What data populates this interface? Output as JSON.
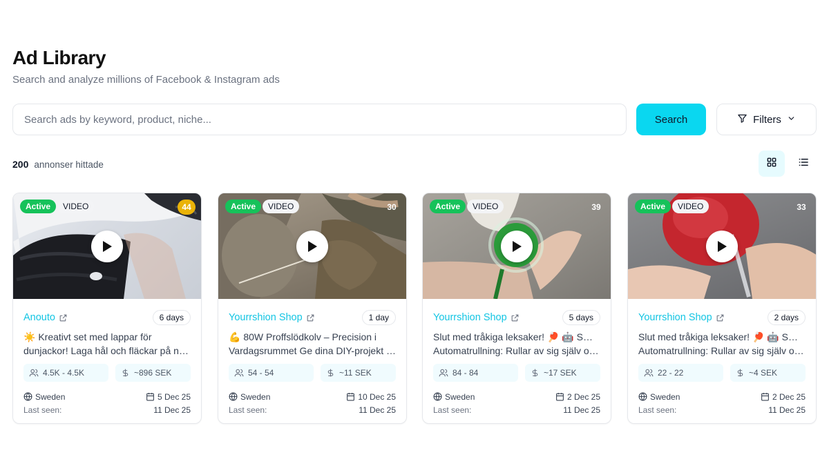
{
  "header": {
    "title": "Ad Library",
    "subtitle": "Search and analyze millions of Facebook & Instagram ads"
  },
  "search": {
    "placeholder": "Search ads by keyword, product, niche...",
    "button_label": "Search",
    "filters_label": "Filters"
  },
  "results": {
    "count": "200",
    "label": "annonser hittade"
  },
  "colors": {
    "accent": "#0ad7f0",
    "link": "#13c5e3",
    "active_badge": "#16c25a",
    "highlight_count": "#eab308"
  },
  "cards": [
    {
      "status": "Active",
      "media_type": "VIDEO",
      "count": "44",
      "count_highlight": true,
      "shop": "Anouto",
      "age": "6 days",
      "desc_line1": "☀️ Kreativt set med lappar för",
      "desc_line2": "dunjackor! Laga hål och fläckar på nollt...",
      "reach": "4.5K - 4.5K",
      "spend": "~896 SEK",
      "country": "Sweden",
      "start_date": "5 Dec 25",
      "last_seen_label": "Last seen:",
      "last_seen": "11 Dec 25"
    },
    {
      "status": "Active",
      "media_type": "VIDEO",
      "count": "30",
      "count_highlight": false,
      "shop": "Yourrshion Shop",
      "age": "1 day",
      "desc_line1": "💪 80W Proffslödkolv – Precision i",
      "desc_line2": "Vardagsrummet Ge dina DIY-projekt oc...",
      "reach": "54 - 54",
      "spend": "~11 SEK",
      "country": "Sweden",
      "start_date": "10 Dec 25",
      "last_seen_label": "Last seen:",
      "last_seen": "11 Dec 25"
    },
    {
      "status": "Active",
      "media_type": "VIDEO",
      "count": "39",
      "count_highlight": false,
      "shop": "Yourrshion Shop",
      "age": "5 days",
      "desc_line1": "Slut med tråkiga leksaker! 🏓 🤖 Smart",
      "desc_line2": "Automatrullning: Rullar av sig själv och...",
      "reach": "84 - 84",
      "spend": "~17 SEK",
      "country": "Sweden",
      "start_date": "2 Dec 25",
      "last_seen_label": "Last seen:",
      "last_seen": "11 Dec 25"
    },
    {
      "status": "Active",
      "media_type": "VIDEO",
      "count": "33",
      "count_highlight": false,
      "shop": "Yourrshion Shop",
      "age": "2 days",
      "desc_line1": "Slut med tråkiga leksaker! 🏓 🤖 Smart",
      "desc_line2": "Automatrullning: Rullar av sig själv och...",
      "reach": "22 - 22",
      "spend": "~4 SEK",
      "country": "Sweden",
      "start_date": "2 Dec 25",
      "last_seen_label": "Last seen:",
      "last_seen": "11 Dec 25"
    }
  ]
}
